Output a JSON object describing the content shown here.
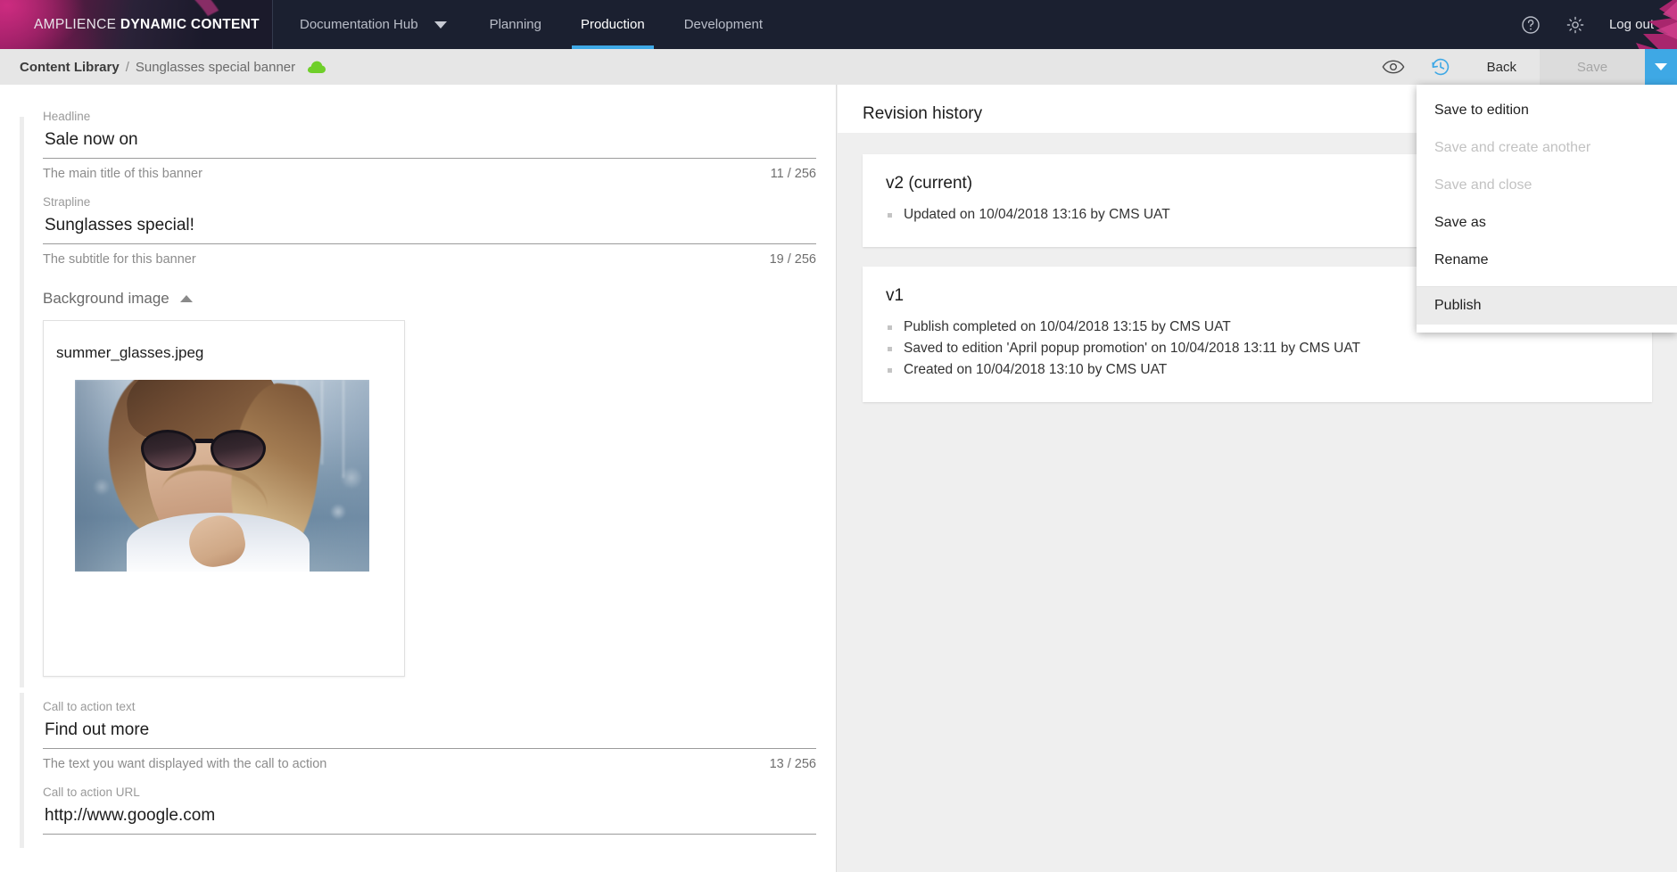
{
  "nav": {
    "logo_light": "AMPLIENCE ",
    "logo_bold": "DYNAMIC CONTENT",
    "items": [
      {
        "label": "Documentation Hub",
        "active": false
      },
      {
        "label": "Planning",
        "active": false
      },
      {
        "label": "Production",
        "active": true
      },
      {
        "label": "Development",
        "active": false
      }
    ],
    "help_icon": "help-circle-icon",
    "settings_icon": "gear-icon",
    "logout_label": "Log out"
  },
  "subheader": {
    "breadcrumb_root": "Content Library",
    "breadcrumb_separator": "/",
    "breadcrumb_current": "Sunglasses special banner",
    "status_icon": "cloud-published-icon",
    "status_color": "#6fcf2a",
    "preview_icon": "eye-icon",
    "history_icon": "history-clock-icon",
    "history_icon_color": "#3ea8e5",
    "back_label": "Back",
    "save_label": "Save",
    "save_disabled": true,
    "caret_icon": "chevron-down-icon",
    "accent_color": "#3ea8e5"
  },
  "save_menu": {
    "items": [
      {
        "label": "Save to edition",
        "disabled": false,
        "highlighted": false
      },
      {
        "label": "Save and create another",
        "disabled": true,
        "highlighted": false
      },
      {
        "label": "Save and close",
        "disabled": true,
        "highlighted": false
      },
      {
        "label": "Save as",
        "disabled": false,
        "highlighted": false
      },
      {
        "label": "Rename",
        "disabled": false,
        "highlighted": false
      }
    ],
    "publish": {
      "label": "Publish",
      "disabled": false,
      "highlighted": true
    }
  },
  "form": {
    "headline": {
      "label": "Headline",
      "value": "Sale now on",
      "help": "The main title of this banner",
      "count": "11 / 256"
    },
    "strapline": {
      "label": "Strapline",
      "value": "Sunglasses special!",
      "help": "The subtitle for this banner",
      "count": "19 / 256"
    },
    "background_image": {
      "label": "Background image",
      "collapse_icon": "chevron-up-icon",
      "file_name": "summer_glasses.jpeg",
      "image_alt": "woman wearing sunglasses at a marina"
    },
    "cta_text": {
      "label": "Call to action text",
      "value": "Find out more",
      "help": "The text you want displayed with the call to action",
      "count": "13 / 256"
    },
    "cta_url": {
      "label": "Call to action URL",
      "value": "http://www.google.com"
    }
  },
  "revision_history": {
    "title": "Revision history",
    "versions": [
      {
        "version": "v2 (current)",
        "events": [
          "Updated on 10/04/2018 13:16 by CMS UAT"
        ]
      },
      {
        "version": "v1",
        "events": [
          "Publish completed on 10/04/2018 13:15 by CMS UAT",
          "Saved to edition 'April popup promotion' on 10/04/2018 13:11 by CMS UAT",
          "Created on 10/04/2018 13:10 by CMS UAT"
        ]
      }
    ]
  }
}
